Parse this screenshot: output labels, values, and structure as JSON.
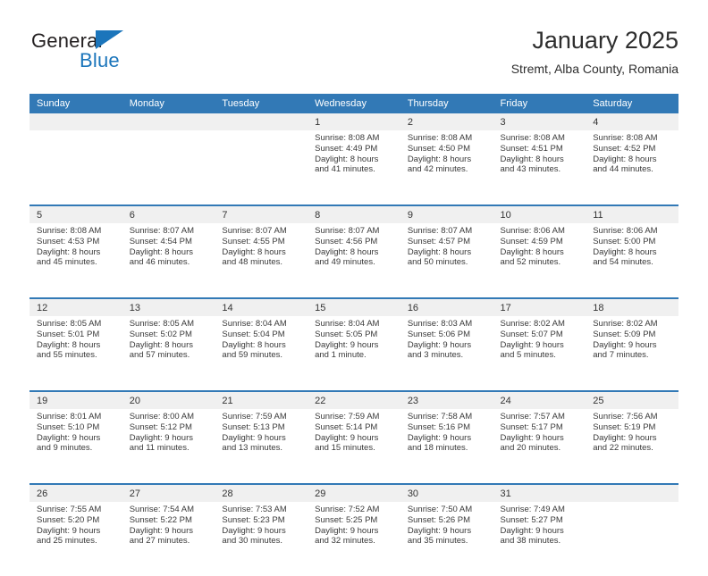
{
  "brand": {
    "name_top": "General",
    "name_bottom": "Blue",
    "triangle_icon": "brand-triangle-icon",
    "colors": {
      "blue": "#1b75bb",
      "dark": "#231f20"
    }
  },
  "header": {
    "title": "January 2025",
    "subtitle": "Stremt, Alba County, Romania"
  },
  "theme": {
    "header_blue": "#3279b6",
    "daynum_band": "#f0f0f0",
    "text": "#3a3a3a"
  },
  "calendar": {
    "weekday_headers": [
      "Sunday",
      "Monday",
      "Tuesday",
      "Wednesday",
      "Thursday",
      "Friday",
      "Saturday"
    ],
    "weeks": [
      [
        {
          "day": "",
          "lines": []
        },
        {
          "day": "",
          "lines": []
        },
        {
          "day": "",
          "lines": []
        },
        {
          "day": "1",
          "lines": [
            "Sunrise: 8:08 AM",
            "Sunset: 4:49 PM",
            "Daylight: 8 hours",
            "and 41 minutes."
          ]
        },
        {
          "day": "2",
          "lines": [
            "Sunrise: 8:08 AM",
            "Sunset: 4:50 PM",
            "Daylight: 8 hours",
            "and 42 minutes."
          ]
        },
        {
          "day": "3",
          "lines": [
            "Sunrise: 8:08 AM",
            "Sunset: 4:51 PM",
            "Daylight: 8 hours",
            "and 43 minutes."
          ]
        },
        {
          "day": "4",
          "lines": [
            "Sunrise: 8:08 AM",
            "Sunset: 4:52 PM",
            "Daylight: 8 hours",
            "and 44 minutes."
          ]
        }
      ],
      [
        {
          "day": "5",
          "lines": [
            "Sunrise: 8:08 AM",
            "Sunset: 4:53 PM",
            "Daylight: 8 hours",
            "and 45 minutes."
          ]
        },
        {
          "day": "6",
          "lines": [
            "Sunrise: 8:07 AM",
            "Sunset: 4:54 PM",
            "Daylight: 8 hours",
            "and 46 minutes."
          ]
        },
        {
          "day": "7",
          "lines": [
            "Sunrise: 8:07 AM",
            "Sunset: 4:55 PM",
            "Daylight: 8 hours",
            "and 48 minutes."
          ]
        },
        {
          "day": "8",
          "lines": [
            "Sunrise: 8:07 AM",
            "Sunset: 4:56 PM",
            "Daylight: 8 hours",
            "and 49 minutes."
          ]
        },
        {
          "day": "9",
          "lines": [
            "Sunrise: 8:07 AM",
            "Sunset: 4:57 PM",
            "Daylight: 8 hours",
            "and 50 minutes."
          ]
        },
        {
          "day": "10",
          "lines": [
            "Sunrise: 8:06 AM",
            "Sunset: 4:59 PM",
            "Daylight: 8 hours",
            "and 52 minutes."
          ]
        },
        {
          "day": "11",
          "lines": [
            "Sunrise: 8:06 AM",
            "Sunset: 5:00 PM",
            "Daylight: 8 hours",
            "and 54 minutes."
          ]
        }
      ],
      [
        {
          "day": "12",
          "lines": [
            "Sunrise: 8:05 AM",
            "Sunset: 5:01 PM",
            "Daylight: 8 hours",
            "and 55 minutes."
          ]
        },
        {
          "day": "13",
          "lines": [
            "Sunrise: 8:05 AM",
            "Sunset: 5:02 PM",
            "Daylight: 8 hours",
            "and 57 minutes."
          ]
        },
        {
          "day": "14",
          "lines": [
            "Sunrise: 8:04 AM",
            "Sunset: 5:04 PM",
            "Daylight: 8 hours",
            "and 59 minutes."
          ]
        },
        {
          "day": "15",
          "lines": [
            "Sunrise: 8:04 AM",
            "Sunset: 5:05 PM",
            "Daylight: 9 hours",
            "and 1 minute."
          ]
        },
        {
          "day": "16",
          "lines": [
            "Sunrise: 8:03 AM",
            "Sunset: 5:06 PM",
            "Daylight: 9 hours",
            "and 3 minutes."
          ]
        },
        {
          "day": "17",
          "lines": [
            "Sunrise: 8:02 AM",
            "Sunset: 5:07 PM",
            "Daylight: 9 hours",
            "and 5 minutes."
          ]
        },
        {
          "day": "18",
          "lines": [
            "Sunrise: 8:02 AM",
            "Sunset: 5:09 PM",
            "Daylight: 9 hours",
            "and 7 minutes."
          ]
        }
      ],
      [
        {
          "day": "19",
          "lines": [
            "Sunrise: 8:01 AM",
            "Sunset: 5:10 PM",
            "Daylight: 9 hours",
            "and 9 minutes."
          ]
        },
        {
          "day": "20",
          "lines": [
            "Sunrise: 8:00 AM",
            "Sunset: 5:12 PM",
            "Daylight: 9 hours",
            "and 11 minutes."
          ]
        },
        {
          "day": "21",
          "lines": [
            "Sunrise: 7:59 AM",
            "Sunset: 5:13 PM",
            "Daylight: 9 hours",
            "and 13 minutes."
          ]
        },
        {
          "day": "22",
          "lines": [
            "Sunrise: 7:59 AM",
            "Sunset: 5:14 PM",
            "Daylight: 9 hours",
            "and 15 minutes."
          ]
        },
        {
          "day": "23",
          "lines": [
            "Sunrise: 7:58 AM",
            "Sunset: 5:16 PM",
            "Daylight: 9 hours",
            "and 18 minutes."
          ]
        },
        {
          "day": "24",
          "lines": [
            "Sunrise: 7:57 AM",
            "Sunset: 5:17 PM",
            "Daylight: 9 hours",
            "and 20 minutes."
          ]
        },
        {
          "day": "25",
          "lines": [
            "Sunrise: 7:56 AM",
            "Sunset: 5:19 PM",
            "Daylight: 9 hours",
            "and 22 minutes."
          ]
        }
      ],
      [
        {
          "day": "26",
          "lines": [
            "Sunrise: 7:55 AM",
            "Sunset: 5:20 PM",
            "Daylight: 9 hours",
            "and 25 minutes."
          ]
        },
        {
          "day": "27",
          "lines": [
            "Sunrise: 7:54 AM",
            "Sunset: 5:22 PM",
            "Daylight: 9 hours",
            "and 27 minutes."
          ]
        },
        {
          "day": "28",
          "lines": [
            "Sunrise: 7:53 AM",
            "Sunset: 5:23 PM",
            "Daylight: 9 hours",
            "and 30 minutes."
          ]
        },
        {
          "day": "29",
          "lines": [
            "Sunrise: 7:52 AM",
            "Sunset: 5:25 PM",
            "Daylight: 9 hours",
            "and 32 minutes."
          ]
        },
        {
          "day": "30",
          "lines": [
            "Sunrise: 7:50 AM",
            "Sunset: 5:26 PM",
            "Daylight: 9 hours",
            "and 35 minutes."
          ]
        },
        {
          "day": "31",
          "lines": [
            "Sunrise: 7:49 AM",
            "Sunset: 5:27 PM",
            "Daylight: 9 hours",
            "and 38 minutes."
          ]
        },
        {
          "day": "",
          "lines": []
        }
      ]
    ]
  }
}
